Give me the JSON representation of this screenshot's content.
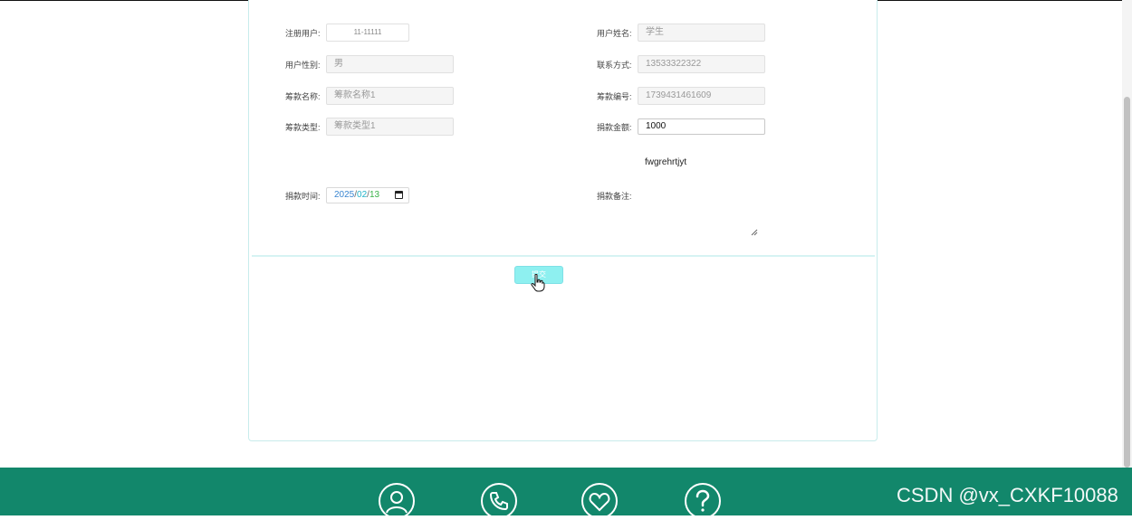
{
  "form": {
    "reg_user_label": "注册用户:",
    "reg_user_value": "11-11111",
    "user_name_label": "用户姓名:",
    "user_name_value": "学生",
    "gender_label": "用户性别:",
    "gender_value": "男",
    "contact_label": "联系方式:",
    "contact_value": "13533322322",
    "fund_name_label": "筹款名称:",
    "fund_name_value": "筹款名称1",
    "fund_no_label": "筹款编号:",
    "fund_no_value": "1739431461609",
    "fund_type_label": "筹款类型:",
    "fund_type_value": "筹款类型1",
    "amount_label": "捐款金额:",
    "amount_value": "1000",
    "donate_time_label": "捐款时间:",
    "donate_date": {
      "year": "2025",
      "month": "02",
      "day": "13",
      "sep": "/"
    },
    "remark_label": "捐款备注:",
    "remark_value": "fwgrehrtjyt",
    "submit_label": "提交"
  },
  "footer": {
    "icons": [
      "user-circle-icon",
      "phone-icon",
      "heart-icon",
      "help-icon"
    ],
    "color": "#12876b"
  },
  "watermark": "CSDN @vx_CXKF10088",
  "colors": {
    "accent": "#8ef0f0",
    "border": "#c8ecec"
  }
}
